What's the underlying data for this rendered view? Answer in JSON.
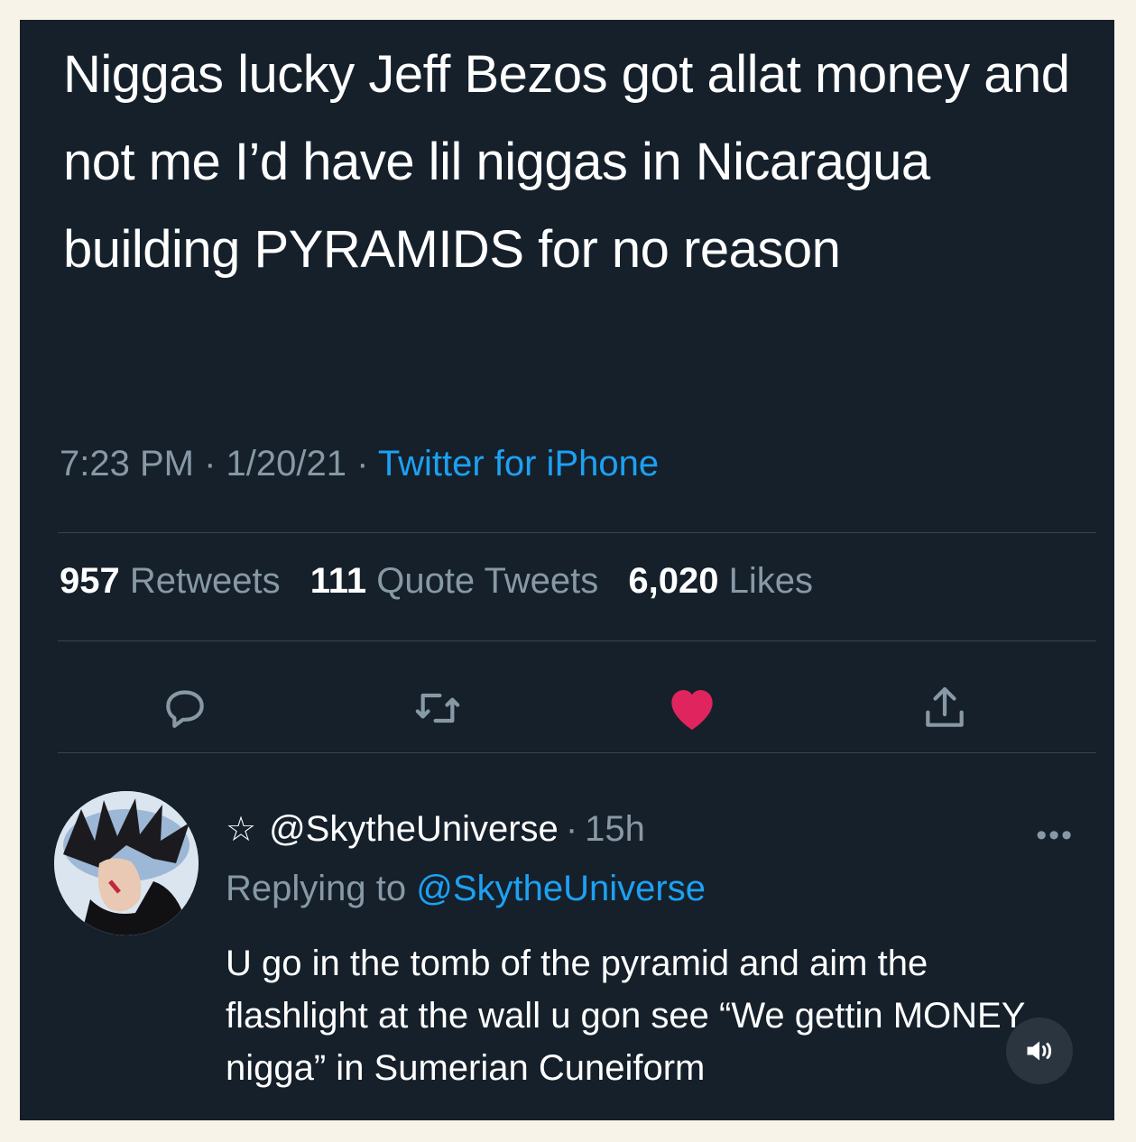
{
  "tweet": {
    "text": "Niggas lucky Jeff Bezos got allat money and not me I’d have lil niggas in Nicaragua building PYRAMIDS for no reason",
    "time": "7:23 PM",
    "date": "1/20/21",
    "separator": "·",
    "source": "Twitter for iPhone"
  },
  "stats": {
    "retweets_count": "957",
    "retweets_label": "Retweets",
    "quotes_count": "111",
    "quotes_label": "Quote Tweets",
    "likes_count": "6,020",
    "likes_label": "Likes"
  },
  "actions": {
    "reply_icon": "comment-icon",
    "retweet_icon": "retweet-icon",
    "like_icon": "heart-icon",
    "share_icon": "share-icon"
  },
  "reply": {
    "star": "☆",
    "handle": "@SkytheUniverse",
    "separator": "·",
    "age": "15h",
    "replying_prefix": "Replying to",
    "replying_to": "@SkytheUniverse",
    "more": "•••",
    "text": "U go in the tomb of the pyramid and aim the flashlight at the wall u gon see “We gettin MONEY nigga” in Sumerian Cuneiform"
  },
  "colors": {
    "background": "#15202b",
    "text": "#ffffff",
    "muted": "#8899a6",
    "accent": "#1da1f2",
    "like": "#e0245e"
  }
}
